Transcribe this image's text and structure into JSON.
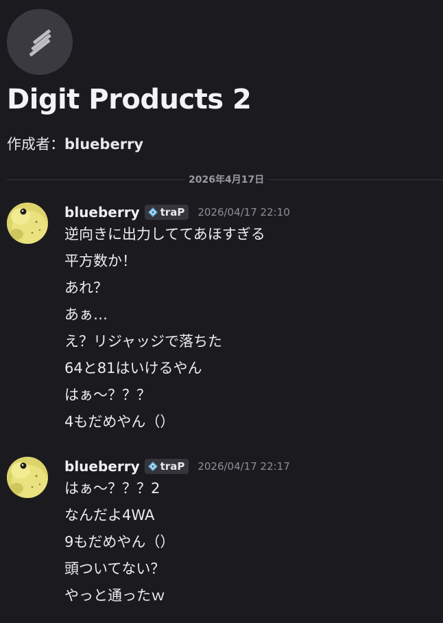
{
  "thread": {
    "title": "Digit Products 2",
    "creator_label": "作成者：",
    "creator_name": "blueberry",
    "icon": "stacked-bars-icon"
  },
  "date_separator": "2026年4月17日",
  "messages": [
    {
      "author": "blueberry",
      "badge": "traP",
      "timestamp": "2026/04/17 22:10",
      "lines": [
        "逆向きに出力しててあほすぎる",
        "平方数か！",
        "あれ？",
        "あぁ…",
        "え？リジャッジで落ちた",
        "64と81はいけるやん",
        "はぁ～？？？",
        "4もだめやん（）"
      ]
    },
    {
      "author": "blueberry",
      "badge": "traP",
      "timestamp": "2026/04/17 22:17",
      "lines": [
        "はぁ～？？？2",
        "なんだよ4WA",
        "9もだめやん（）",
        "頭ついてない？",
        "やっと通ったｗ"
      ]
    }
  ],
  "colors": {
    "background": "#1b1b1f",
    "text": "#ededf0",
    "muted": "#8e8e96",
    "badge_bg": "#35353c"
  }
}
